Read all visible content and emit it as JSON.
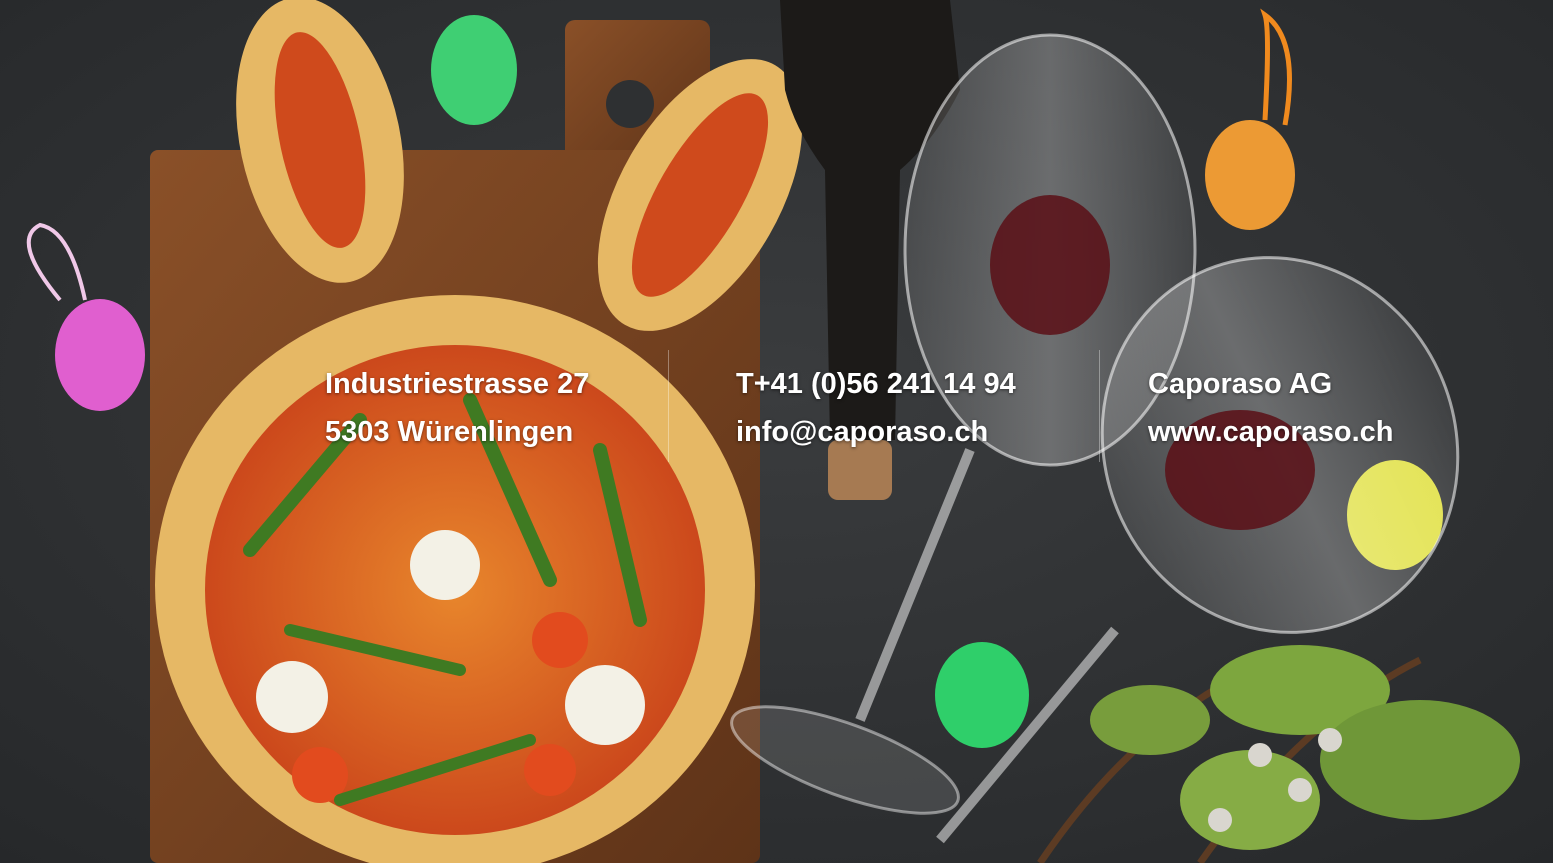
{
  "background": {
    "colors": {
      "slate": "#2e3032",
      "board": "#7a4524",
      "crust": "#e6b865",
      "sauce": "#d9531e",
      "wine": "#5a0f16"
    }
  },
  "footer": {
    "address": {
      "street": "Industriestrasse 27",
      "city": "5303 Würenlingen"
    },
    "contact": {
      "phone": "T+41 (0)56 241 14 94",
      "email": "info@caporaso.ch"
    },
    "company": {
      "name": "Caporaso AG",
      "website": "www.caporaso.ch"
    }
  }
}
